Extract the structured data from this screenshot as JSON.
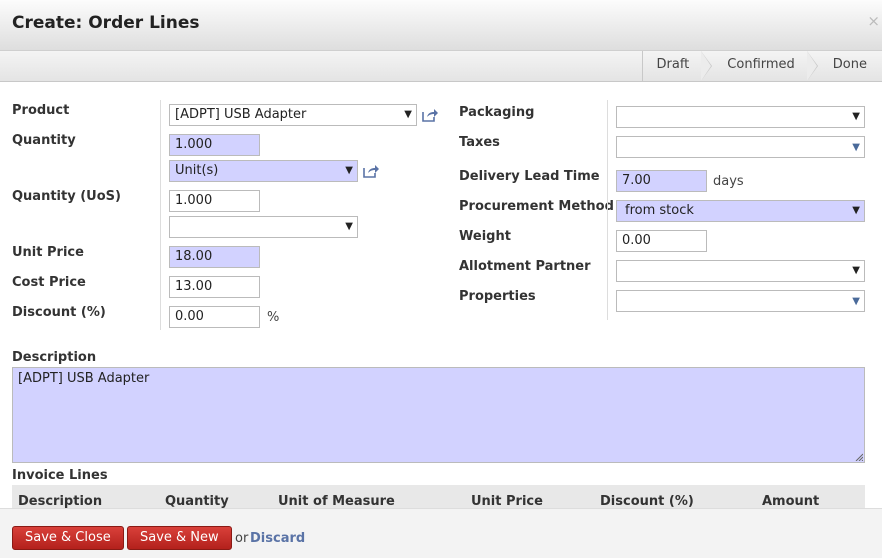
{
  "dialog": {
    "title": "Create: Order Lines",
    "close": "×"
  },
  "status": {
    "steps": [
      "Draft",
      "Confirmed",
      "Done"
    ]
  },
  "left": {
    "product_label": "Product",
    "product_value": "[ADPT] USB Adapter",
    "quantity_label": "Quantity",
    "quantity_value": "1.000",
    "uom_value": "Unit(s)",
    "quantity_uos_label": "Quantity (UoS)",
    "quantity_uos_value": "1.000",
    "uos_value": "",
    "unit_price_label": "Unit Price",
    "unit_price_value": "18.00",
    "cost_price_label": "Cost Price",
    "cost_price_value": "13.00",
    "discount_label": "Discount (%)",
    "discount_value": "0.00",
    "discount_unit": "%"
  },
  "right": {
    "packaging_label": "Packaging",
    "packaging_value": "",
    "taxes_label": "Taxes",
    "taxes_value": "",
    "delay_label": "Delivery Lead Time",
    "delay_value": "7.00",
    "delay_unit": "days",
    "procurement_label": "Procurement Method",
    "procurement_value": "from stock",
    "weight_label": "Weight",
    "weight_value": "0.00",
    "allotment_label": "Allotment Partner",
    "allotment_value": "",
    "properties_label": "Properties",
    "properties_value": ""
  },
  "description": {
    "label": "Description",
    "value": "[ADPT] USB Adapter"
  },
  "invoice_lines": {
    "label": "Invoice Lines",
    "columns": [
      "Description",
      "Quantity",
      "Unit of Measure",
      "Unit Price",
      "Discount (%)",
      "Amount"
    ]
  },
  "footer": {
    "save_close": "Save & Close",
    "save_new": "Save & New",
    "or": "or",
    "discard": "Discard"
  },
  "colors": {
    "required_bg": "#d2d2ff",
    "primary_btn": "#c0302a",
    "link": "#5a73a6"
  }
}
